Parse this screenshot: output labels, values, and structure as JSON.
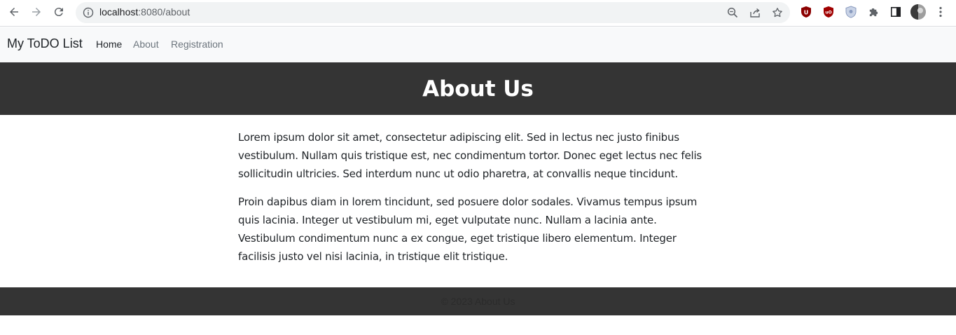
{
  "browser": {
    "url_host": "localhost",
    "url_rest": ":8080/about"
  },
  "navbar": {
    "brand": "My ToDO List",
    "links": [
      {
        "label": "Home"
      },
      {
        "label": "About"
      },
      {
        "label": "Registration"
      }
    ]
  },
  "header": {
    "title": "About Us"
  },
  "content": {
    "paragraphs": [
      "Lorem ipsum dolor sit amet, consectetur adipiscing elit. Sed in lectus nec justo finibus vestibulum. Nullam quis tristique est, nec condimentum tortor. Donec eget lectus nec felis sollicitudin ultricies. Sed interdum nunc ut odio pharetra, at convallis neque tincidunt.",
      "Proin dapibus diam in lorem tincidunt, sed posuere dolor sodales. Vivamus tempus ipsum quis lacinia. Integer ut vestibulum mi, eget vulputate nunc. Nullam a lacinia ante. Vestibulum condimentum nunc a ex congue, eget tristique libero elementum. Integer facilisis justo vel nisi lacinia, in tristique elit tristique."
    ]
  },
  "footer": {
    "text": "© 2023 About Us"
  }
}
